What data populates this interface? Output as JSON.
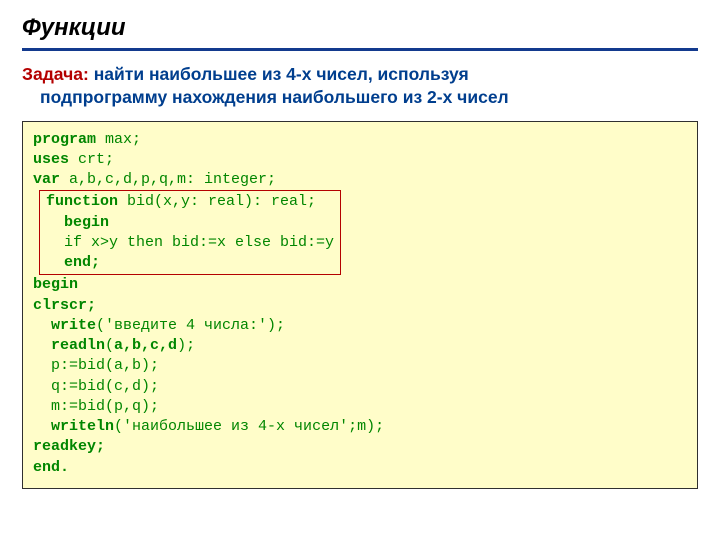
{
  "title": "Функции",
  "task": {
    "label": "Задача:",
    "line1": " найти наибольшее из 4-х чисел, используя",
    "line2": "подпрограмму нахождения наибольшего из 2-х чисел"
  },
  "code": {
    "l1_kw": "program",
    "l1_txt": " max;",
    "l2_kw": "uses",
    "l2_txt": " crt;",
    "l3_kw": "var",
    "l3_txt": " a,b,c,d,p,q,m: integer;",
    "f1_kw": "function",
    "f1_txt": " bid(x,y: real): real;",
    "f2_kw": "begin",
    "f3_txt": "if x>y then bid:=x else bid:=y",
    "f4_kw": "end;",
    "l4_kw": "begin",
    "l5_kw": "clrscr;",
    "l6_kw": "write",
    "l6_txt": "('введите 4 числа:');",
    "l7_kw": "readln",
    "l7_txt": "(",
    "l7_b": "a,b,c,d",
    "l7_txt2": ");",
    "l8_txt": "p:=bid(a,b);",
    "l9_txt": "q:=bid(c,d);",
    "l10_txt": "m:=bid(p,q);",
    "l11_kw": "writeln",
    "l11_txt": "('наибольшее из 4-х чисел';m);",
    "l12_kw": "readkey;",
    "l13_kw": "end."
  }
}
